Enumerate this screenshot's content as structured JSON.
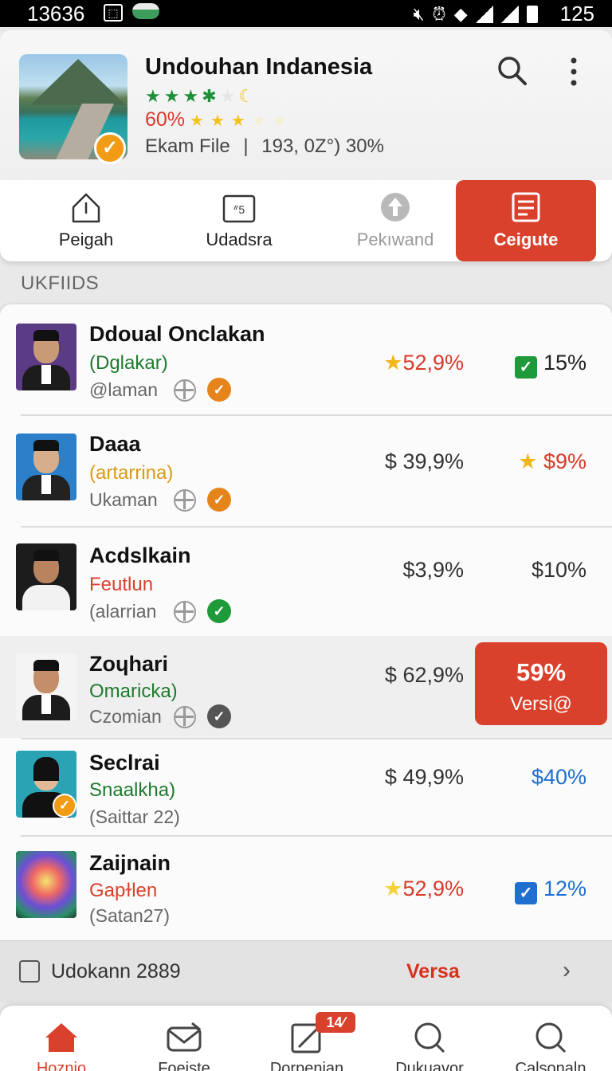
{
  "status_bar": {
    "time": "13636",
    "right_number": "125",
    "icons": [
      "image-icon",
      "app-icon",
      "mute-icon",
      "alarm-icon",
      "wifi-icon",
      "signal-icon",
      "signal-icon",
      "battery-icon"
    ]
  },
  "app_header": {
    "title": "Undouhan Indanesia",
    "rating_percent": "60%",
    "file_label": "Ekam File",
    "separator": "|",
    "file_stats": "193, 0Z°) 30%",
    "search_icon": "search-icon",
    "more_icon": "more-vert-icon"
  },
  "actions": [
    {
      "label": "Peigah",
      "icon": "share-icon",
      "state": "normal"
    },
    {
      "label": "Udadsra",
      "icon": "calendar-icon",
      "state": "normal"
    },
    {
      "label": "Pekıwand",
      "icon": "upload-icon",
      "state": "disabled"
    },
    {
      "label": "Ceigute",
      "icon": "document-icon",
      "state": "primary"
    }
  ],
  "section": {
    "title": "UKFIIDS"
  },
  "list": [
    {
      "name": "Ddoual Onclakan",
      "sub": "(Dglakar)",
      "sub_color": "#1f7a2f",
      "meta": "@laman",
      "status_color": "#e6841c",
      "val1": "52,9%",
      "val1_icon": "star",
      "val1_color": "#d93a2b",
      "val2": "15%",
      "val2_icon": "check",
      "val2_icon_color": "#1f9a3a",
      "val2_color": "#222"
    },
    {
      "name": "Daaa",
      "sub": "(artarrina)",
      "sub_color": "#d99a14",
      "meta": "Ukaman",
      "status_color": "#e6841c",
      "val1": "$ 39,9%",
      "val1_color": "#333",
      "val2": "$9%",
      "val2_icon": "star",
      "val2_color": "#d93a2b"
    },
    {
      "name": "Acdslkain",
      "sub": "Feutlun",
      "sub_color": "#d9412d",
      "meta": "(alarrian",
      "status_color": "#1f9a3a",
      "val1": "$3,9%",
      "val1_color": "#333",
      "val2": "$10%",
      "val2_color": "#333"
    },
    {
      "name": "Zoɥhari",
      "sub": "Omaricka)",
      "sub_color": "#1f7a2f",
      "meta": "Czomian",
      "status_color": "#555555",
      "val1": "$ 62,9%",
      "val1_color": "#333",
      "version": {
        "percent": "59%",
        "label": "Versi@"
      }
    },
    {
      "name": "Seclrai",
      "sub": "Snaalkha)",
      "sub_color": "#1f7a2f",
      "meta": "(Saittar 22)",
      "val1": "$ 49,9%",
      "val1_color": "#333",
      "val2": "$40%",
      "val2_color": "#1f6fd1"
    },
    {
      "name": "Zaijnain",
      "sub": "Gapɫlen",
      "sub_color": "#d9412d",
      "meta": "(Satan27)",
      "val1": "52,9%",
      "val1_icon": "star",
      "val1_color": "#d93a2b",
      "val2": "12%",
      "val2_icon": "check",
      "val2_icon_color": "#1f6fd1",
      "val2_color": "#1f6fd1"
    }
  ],
  "footer_bar": {
    "label": "Udokann 2889",
    "link": "Versa",
    "chevron_icon": "chevron-right-icon"
  },
  "bottom_nav": {
    "badge": "14⁄",
    "items": [
      {
        "label": "Hoznio",
        "icon": "home-icon",
        "active": true
      },
      {
        "label": "Foeiste",
        "icon": "mail-icon",
        "active": false
      },
      {
        "label": "Dorpenian",
        "icon": "edit-icon",
        "active": false
      },
      {
        "label": "Dukuavor",
        "icon": "search-icon",
        "active": false
      },
      {
        "label": "Calsonaln",
        "icon": "search-icon",
        "active": false
      }
    ]
  },
  "colors": {
    "accent": "#d9412d",
    "badge_orange": "#f29b14",
    "green": "#1f9a3a",
    "blue": "#1f6fd1"
  }
}
